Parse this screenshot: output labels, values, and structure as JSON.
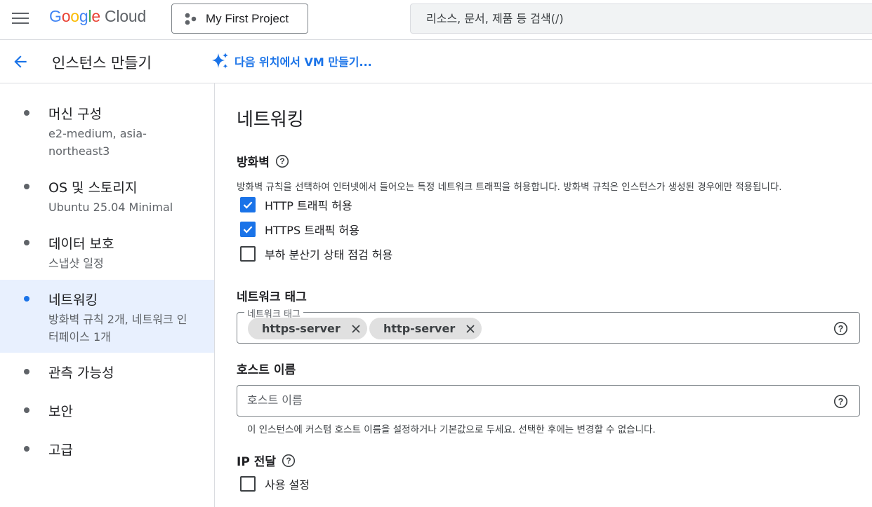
{
  "topbar": {
    "logo_google": "Google",
    "logo_cloud": "Cloud",
    "project": "My First Project",
    "search_placeholder": "리소스, 문서, 제품 등 검색(/)"
  },
  "titlebar": {
    "title": "인스턴스 만들기",
    "ai_link": "다음 위치에서 VM 만들기..."
  },
  "sidebar": {
    "steps": [
      {
        "title": "머신 구성",
        "subtitle": "e2-medium, asia-northeast3"
      },
      {
        "title": "OS 및 스토리지",
        "subtitle": "Ubuntu 25.04 Minimal"
      },
      {
        "title": "데이터 보호",
        "subtitle": "스냅샷 일정"
      },
      {
        "title": "네트워킹",
        "subtitle": "방화벽 규칙 2개, 네트워크 인터페이스 1개",
        "active": true
      },
      {
        "title": "관측 가능성"
      },
      {
        "title": "보안"
      },
      {
        "title": "고급"
      }
    ]
  },
  "main": {
    "heading": "네트워킹",
    "firewall": {
      "label": "방화벽",
      "description": "방화벽 규칙을 선택하여 인터넷에서 들어오는 특정 네트워크 트래픽을 허용합니다. 방화벽 규칙은 인스턴스가 생성된 경우에만 적용됩니다.",
      "options": [
        {
          "label": "HTTP 트래픽 허용",
          "checked": true
        },
        {
          "label": "HTTPS 트래픽 허용",
          "checked": true
        },
        {
          "label": "부하 분산기 상태 점검 허용",
          "checked": false
        }
      ]
    },
    "network_tags": {
      "label": "네트워크 태그",
      "legend": "네트워크 태그",
      "chips": [
        "https-server",
        "http-server"
      ]
    },
    "hostname": {
      "label": "호스트 이름",
      "placeholder": "호스트 이름",
      "hint": "이 인스턴스에 커스텀 호스트 이름을 설정하거나 기본값으로 두세요. 선택한 후에는 변경할 수 없습니다."
    },
    "ip_forwarding": {
      "label": "IP 전달",
      "option": {
        "label": "사용 설정",
        "checked": false
      }
    }
  },
  "colors": {
    "accent": "#1a73e8",
    "active_bg": "#e8f0fe",
    "chip_bg": "#e0e0e0",
    "google_blue": "#4285f4",
    "google_red": "#ea4335",
    "google_yellow": "#fbbc04",
    "google_green": "#34a853"
  }
}
